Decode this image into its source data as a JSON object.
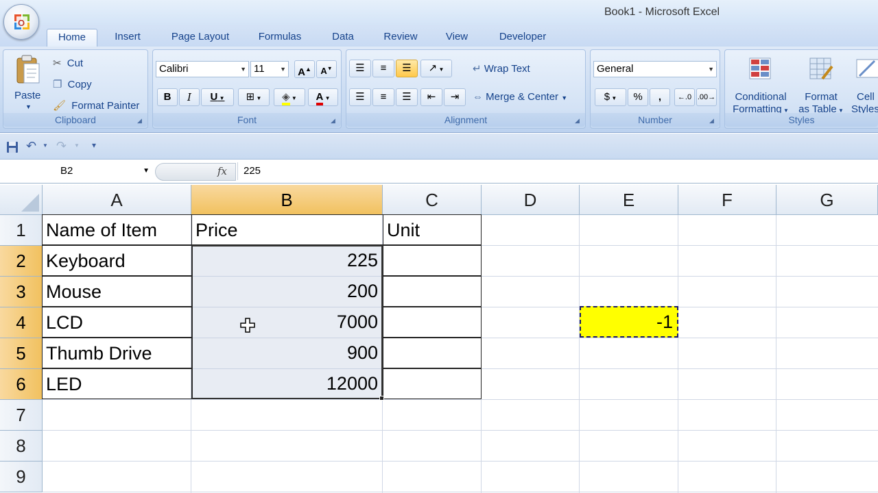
{
  "window": {
    "title": "Book1 - Microsoft Excel"
  },
  "tabs": [
    "Home",
    "Insert",
    "Page Layout",
    "Formulas",
    "Data",
    "Review",
    "View",
    "Developer"
  ],
  "ribbon": {
    "clipboard": {
      "label": "Clipboard",
      "paste": "Paste",
      "cut": "Cut",
      "copy": "Copy",
      "format_painter": "Format Painter"
    },
    "font": {
      "label": "Font",
      "name": "Calibri",
      "size": "11",
      "bold": "B",
      "italic": "I",
      "underline": "U"
    },
    "alignment": {
      "label": "Alignment",
      "wrap_text": "Wrap Text",
      "merge_center": "Merge & Center"
    },
    "number": {
      "label": "Number",
      "format": "General",
      "percent": "%",
      "comma": ","
    },
    "styles": {
      "label": "Styles",
      "conditional_formatting_1": "Conditional",
      "conditional_formatting_2": "Formatting",
      "format_table_1": "Format",
      "format_table_2": "as Table",
      "cell_styles_1": "Cell",
      "cell_styles_2": "Styles"
    }
  },
  "formula_bar": {
    "name_box": "B2",
    "fx": "fx",
    "value": "225"
  },
  "colors": {
    "selection_header": "#f1c15f",
    "highlight_cell": "#ffff00"
  },
  "grid": {
    "columns": [
      "A",
      "B",
      "C",
      "D",
      "E",
      "F",
      "G"
    ],
    "rows": [
      "1",
      "2",
      "3",
      "4",
      "5",
      "6",
      "7",
      "8",
      "9"
    ],
    "selected_column": "B",
    "selected_rows": [
      "2",
      "3",
      "4",
      "5",
      "6"
    ],
    "cells": {
      "A1": "Name of Item",
      "B1": "Price",
      "C1": "Unit",
      "A2": "Keyboard",
      "B2": "225",
      "A3": "Mouse",
      "B3": "200",
      "A4": "LCD",
      "B4": "7000",
      "A5": "Thumb Drive",
      "B5": "900",
      "A6": "LED",
      "B6": "12000",
      "E4": "-1"
    }
  }
}
